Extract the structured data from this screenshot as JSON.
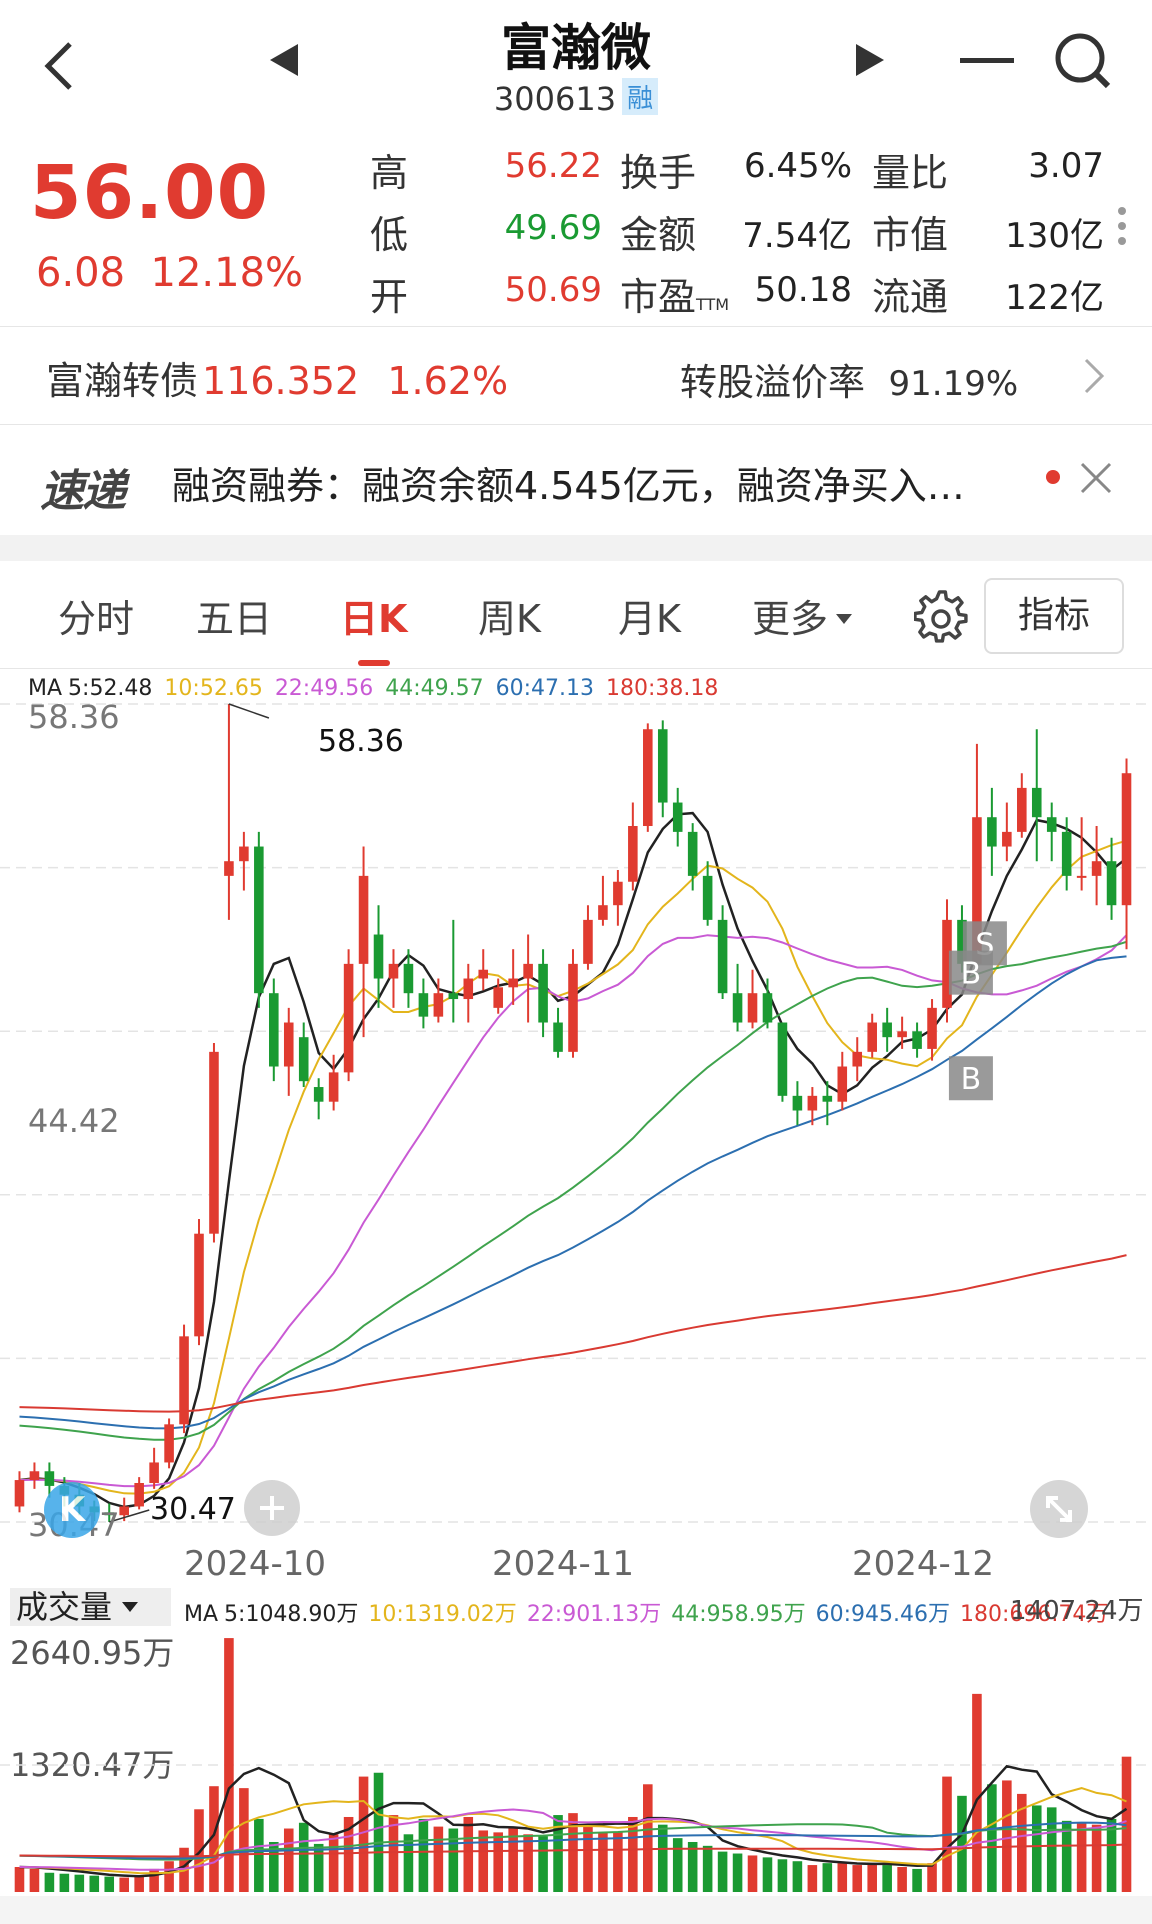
{
  "header": {
    "back_icon": "chevron-left-icon",
    "prev_icon": "triangle-left-icon",
    "next_icon": "triangle-right-icon",
    "menu_icon": "minus-icon",
    "search_icon": "search-icon",
    "title": "富瀚微",
    "code": "300613",
    "badge": "融"
  },
  "quote": {
    "price": "56.00",
    "change": "6.08",
    "change_pct": "12.18%",
    "stats": [
      {
        "label": "高",
        "value": "56.22"
      },
      {
        "label": "换手",
        "value": "6.45%"
      },
      {
        "label": "量比",
        "value": "3.07"
      },
      {
        "label": "低",
        "value": "49.69"
      },
      {
        "label": "金额",
        "value": "7.54亿"
      },
      {
        "label": "市值",
        "value": "130亿"
      },
      {
        "label": "开",
        "value": "50.69"
      },
      {
        "label": "市盈",
        "value": "50.18"
      },
      {
        "label": "流通",
        "value": "122亿"
      }
    ],
    "ttm_sub": "TTM",
    "more_icon": "vertical-dots-icon"
  },
  "bond": {
    "name": "富瀚转债",
    "price": "116.352",
    "pct": "1.62%",
    "premium_label": "转股溢价率",
    "premium_value": "91.19%",
    "arrow_icon": "chevron-right-icon"
  },
  "news": {
    "logo": "速递",
    "text": "融资融券：融资余额4.545亿元，融资净买入…",
    "dot_icon": "red-dot-icon",
    "close_icon": "close-icon"
  },
  "tabs": [
    "分时",
    "五日",
    "日K",
    "周K",
    "月K",
    "更多"
  ],
  "active_tab": "日K",
  "settings_icon": "gear-icon",
  "indicator_button": "指标",
  "ma": {
    "label": "MA",
    "items": [
      {
        "text": "5:52.48",
        "color": "#222222"
      },
      {
        "text": "10:52.65",
        "color": "#e3b51c"
      },
      {
        "text": "22:49.56",
        "color": "#c95ad4"
      },
      {
        "text": "44:49.57",
        "color": "#3fa34d"
      },
      {
        "text": "60:47.13",
        "color": "#2c6fb0"
      },
      {
        "text": "180:38.18",
        "color": "#d93a32"
      }
    ]
  },
  "price_axis": {
    "top": "58.36",
    "mid": "44.42",
    "bottom": "30.47"
  },
  "annotations": {
    "high": "58.36",
    "low": "30.47",
    "signals": [
      "S",
      "B",
      "B"
    ]
  },
  "dates": [
    "2024-10",
    "2024-11",
    "2024-12"
  ],
  "volume": {
    "dropdown": "成交量",
    "ma_label": "MA",
    "items": [
      {
        "text": "5:1048.90万",
        "color": "#222222"
      },
      {
        "text": "10:1319.02万",
        "color": "#e3b51c"
      },
      {
        "text": "22:901.13万",
        "color": "#c95ad4"
      },
      {
        "text": "44:958.95万",
        "color": "#3fa34d"
      },
      {
        "text": "60:945.46万",
        "color": "#2c6fb0"
      },
      {
        "text": "180:696.74万",
        "color": "#d93a32"
      }
    ],
    "latest": "1407.24万",
    "axis_top": "2640.95万",
    "axis_mid": "1320.47万"
  },
  "colors": {
    "up": "#e03b30",
    "down": "#1a9a32"
  },
  "chart_data": {
    "type": "candlestick",
    "price_range": [
      30.47,
      58.36
    ],
    "candles": [
      [
        31.0,
        31.9,
        30.8,
        32.2
      ],
      [
        31.9,
        32.2,
        31.6,
        32.5
      ],
      [
        32.2,
        31.7,
        31.3,
        32.5
      ],
      [
        31.7,
        31.4,
        31.0,
        32.0
      ],
      [
        31.4,
        31.0,
        30.7,
        31.8
      ],
      [
        31.0,
        30.8,
        30.5,
        31.2
      ],
      [
        30.8,
        30.7,
        30.47,
        31.1
      ],
      [
        30.7,
        31.0,
        30.5,
        31.3
      ],
      [
        31.0,
        31.8,
        30.9,
        32.0
      ],
      [
        31.8,
        32.5,
        31.6,
        33.0
      ],
      [
        32.5,
        33.8,
        32.3,
        34.0
      ],
      [
        33.8,
        36.8,
        33.5,
        37.2
      ],
      [
        36.8,
        40.3,
        36.5,
        40.8
      ],
      [
        40.3,
        46.5,
        40.0,
        46.8
      ],
      [
        52.5,
        53.0,
        51.0,
        58.36
      ],
      [
        53.0,
        53.5,
        52.0,
        54.0
      ],
      [
        53.5,
        48.5,
        48.0,
        54.0
      ],
      [
        48.5,
        46.0,
        45.5,
        49.0
      ],
      [
        46.0,
        47.5,
        45.0,
        48.0
      ],
      [
        47.0,
        45.5,
        45.3,
        47.5
      ],
      [
        45.3,
        44.8,
        44.2,
        45.6
      ],
      [
        44.8,
        45.8,
        44.5,
        46.4
      ],
      [
        45.8,
        49.5,
        45.5,
        50.0
      ],
      [
        49.5,
        52.5,
        47.0,
        53.5
      ],
      [
        50.5,
        49.0,
        48.0,
        51.5
      ],
      [
        49.0,
        49.5,
        48.0,
        50.0
      ],
      [
        49.5,
        48.5,
        48.0,
        50.0
      ],
      [
        48.5,
        47.7,
        47.3,
        49.0
      ],
      [
        47.7,
        48.5,
        47.5,
        49.0
      ],
      [
        48.5,
        48.3,
        47.5,
        51.0
      ],
      [
        48.3,
        49.0,
        47.5,
        49.5
      ],
      [
        49.0,
        49.3,
        48.6,
        50.0
      ],
      [
        48.0,
        48.7,
        47.8,
        49.0
      ],
      [
        48.7,
        49.0,
        48.1,
        50.0
      ],
      [
        49.0,
        49.5,
        47.5,
        50.5
      ],
      [
        49.5,
        47.5,
        47.0,
        50.0
      ],
      [
        47.5,
        46.5,
        46.3,
        48.0
      ],
      [
        46.5,
        49.5,
        46.3,
        50.0
      ],
      [
        49.5,
        51.0,
        49.3,
        51.5
      ],
      [
        51.0,
        51.5,
        50.8,
        52.5
      ],
      [
        51.5,
        52.3,
        50.8,
        52.7
      ],
      [
        52.3,
        54.2,
        52.0,
        55.0
      ],
      [
        54.2,
        57.5,
        54.0,
        57.7
      ],
      [
        57.5,
        55.0,
        54.5,
        57.8
      ],
      [
        55.0,
        54.0,
        53.5,
        55.5
      ],
      [
        54.0,
        52.5,
        52.0,
        54.3
      ],
      [
        52.5,
        51.0,
        50.8,
        53.0
      ],
      [
        51.0,
        48.5,
        48.3,
        51.5
      ],
      [
        48.5,
        47.5,
        47.2,
        49.5
      ],
      [
        47.5,
        48.5,
        47.3,
        49.3
      ],
      [
        48.5,
        47.5,
        47.3,
        49.0
      ],
      [
        47.5,
        45.0,
        44.8,
        47.5
      ],
      [
        45.0,
        44.5,
        44.0,
        45.5
      ],
      [
        44.5,
        45.0,
        44.0,
        45.3
      ],
      [
        45.0,
        44.8,
        44.0,
        45.5
      ],
      [
        44.8,
        46.0,
        44.5,
        46.5
      ],
      [
        46.0,
        46.5,
        45.5,
        47.0
      ],
      [
        46.5,
        47.5,
        46.3,
        47.8
      ],
      [
        47.5,
        47.0,
        46.5,
        48.0
      ],
      [
        47.0,
        47.2,
        46.6,
        47.7
      ],
      [
        47.2,
        46.6,
        46.3,
        47.5
      ],
      [
        46.6,
        48.0,
        46.2,
        48.3
      ],
      [
        48.0,
        51.0,
        47.5,
        51.7
      ],
      [
        51.0,
        49.5,
        49.2,
        51.5
      ],
      [
        49.5,
        54.5,
        49.3,
        57.0
      ],
      [
        54.5,
        53.5,
        52.5,
        55.5
      ],
      [
        53.5,
        54.0,
        53.0,
        55.0
      ],
      [
        54.0,
        55.5,
        53.8,
        56.0
      ],
      [
        55.5,
        54.5,
        53.0,
        57.5
      ],
      [
        54.5,
        54.0,
        53.0,
        55.0
      ],
      [
        54.0,
        52.5,
        52.0,
        54.5
      ],
      [
        52.5,
        52.5,
        52.0,
        54.5
      ],
      [
        52.5,
        53.0,
        51.5,
        54.2
      ],
      [
        53.0,
        51.5,
        51.0,
        53.8
      ],
      [
        51.5,
        56.0,
        50.0,
        56.5
      ]
    ],
    "volumes": [
      260,
      240,
      200,
      190,
      180,
      170,
      160,
      150,
      160,
      240,
      320,
      460,
      860,
      1100,
      2640,
      1080,
      760,
      520,
      660,
      720,
      500,
      600,
      780,
      1200,
      1240,
      800,
      600,
      760,
      680,
      660,
      780,
      640,
      620,
      660,
      600,
      580,
      800,
      820,
      700,
      620,
      620,
      780,
      1120,
      700,
      560,
      520,
      480,
      420,
      400,
      380,
      360,
      340,
      320,
      280,
      300,
      300,
      280,
      300,
      280,
      260,
      240,
      300,
      1200,
      1000,
      2060,
      1120,
      1160,
      1020,
      900,
      880,
      740,
      720,
      700,
      760,
      1407
    ]
  }
}
